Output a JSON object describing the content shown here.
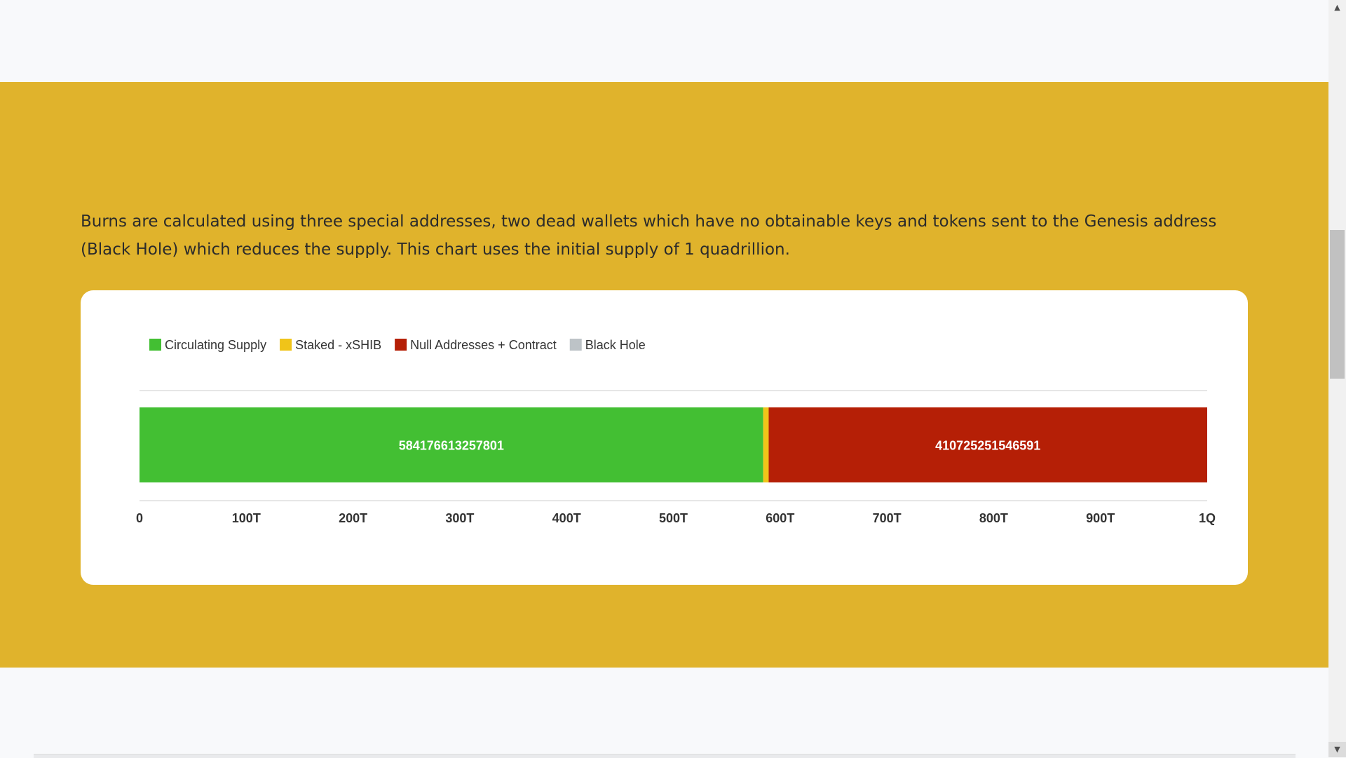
{
  "description": "Burns are calculated using three special addresses, two dead wallets which have no obtainable keys and tokens sent to the Genesis address (Black Hole) which reduces the supply. This chart uses the initial supply of 1 quadrillion.",
  "chart_data": {
    "type": "bar",
    "orientation": "horizontal",
    "stacked": true,
    "categories": [
      ""
    ],
    "series": [
      {
        "name": "Circulating Supply",
        "values": [
          584176613257801
        ],
        "color": "#43bf33",
        "label": "584176613257801"
      },
      {
        "name": "Staked - xSHIB",
        "values": [
          5098135195608
        ],
        "color": "#f0c419",
        "label": ""
      },
      {
        "name": "Null Addresses + Contract",
        "values": [
          410725251546591
        ],
        "color": "#b51f06",
        "label": "410725251546591"
      },
      {
        "name": "Black Hole",
        "values": [
          0
        ],
        "color": "#bdc3c7",
        "label": ""
      }
    ],
    "xlim": [
      0,
      1000000000000000
    ],
    "xticks": [
      {
        "value": 0,
        "label": "0"
      },
      {
        "value": 100000000000000,
        "label": "100T"
      },
      {
        "value": 200000000000000,
        "label": "200T"
      },
      {
        "value": 300000000000000,
        "label": "300T"
      },
      {
        "value": 400000000000000,
        "label": "400T"
      },
      {
        "value": 500000000000000,
        "label": "500T"
      },
      {
        "value": 600000000000000,
        "label": "600T"
      },
      {
        "value": 700000000000000,
        "label": "700T"
      },
      {
        "value": 800000000000000,
        "label": "800T"
      },
      {
        "value": 900000000000000,
        "label": "900T"
      },
      {
        "value": 1000000000000000,
        "label": "1Q"
      }
    ],
    "legend_position": "top-left",
    "grid": false
  },
  "colors": {
    "band": "#e0b32c",
    "page": "#f8f9fb",
    "card": "#ffffff"
  },
  "scrollbar": {
    "up_icon": "triangle-up-icon",
    "down_icon": "triangle-down-icon"
  }
}
